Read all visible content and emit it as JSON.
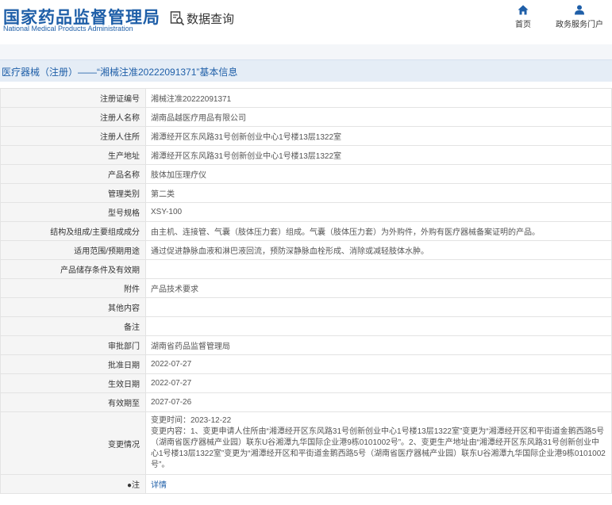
{
  "header": {
    "site_title": "国家药品监督管理局",
    "site_title_en": "National Medical Products Administration",
    "query_label": "数据查询",
    "nav_home": "首页",
    "nav_services": "政务服务门户"
  },
  "page": {
    "section_title": "医疗器械（注册）——“湘械注准20222091371”基本信息"
  },
  "table": {
    "rows": [
      {
        "label": "注册证编号",
        "value": "湘械注准20222091371"
      },
      {
        "label": "注册人名称",
        "value": "湖南品越医疗用品有限公司"
      },
      {
        "label": "注册人住所",
        "value": "湘潭经开区东风路31号创新创业中心1号楼13层1322室"
      },
      {
        "label": "生产地址",
        "value": "湘潭经开区东风路31号创新创业中心1号楼13层1322室"
      },
      {
        "label": "产品名称",
        "value": "肢体加压理疗仪"
      },
      {
        "label": "管理类别",
        "value": "第二类"
      },
      {
        "label": "型号规格",
        "value": "XSY-100"
      },
      {
        "label": "结构及组成/主要组成成分",
        "value": "由主机、连接管、气囊（肢体压力套）组成。气囊（肢体压力套）为外购件，外购有医疗器械备案证明的产品。"
      },
      {
        "label": "适用范围/预期用途",
        "value": "通过促进静脉血液和淋巴液回流，预防深静脉血栓形成、消除或减轻肢体水肿。"
      },
      {
        "label": "产品储存条件及有效期",
        "value": ""
      },
      {
        "label": "附件",
        "value": "产品技术要求"
      },
      {
        "label": "其他内容",
        "value": ""
      },
      {
        "label": "备注",
        "value": ""
      },
      {
        "label": "审批部门",
        "value": "湖南省药品监督管理局"
      },
      {
        "label": "批准日期",
        "value": "2022-07-27"
      },
      {
        "label": "生效日期",
        "value": "2022-07-27"
      },
      {
        "label": "有效期至",
        "value": "2027-07-26"
      }
    ],
    "change": {
      "label": "变更情况",
      "time": "变更时间：2023-12-22",
      "content": "变更内容：1、变更申请人住所由“湘潭经开区东风路31号创新创业中心1号楼13层1322室”变更为“湘潭经开区和平街道金鹅西路5号（湖南省医疗器械产业园）联东U谷湘潭九华国际企业港9栋0101002号”。2、变更生产地址由“湘潭经开区东风路31号创新创业中心1号楼13层1322室”变更为“湘潭经开区和平街道金鹅西路5号（湖南省医疗器械产业园）联东U谷湘潭九华国际企业港9栋0101002号”。"
    },
    "note": {
      "label": "注",
      "link": "详情"
    }
  }
}
